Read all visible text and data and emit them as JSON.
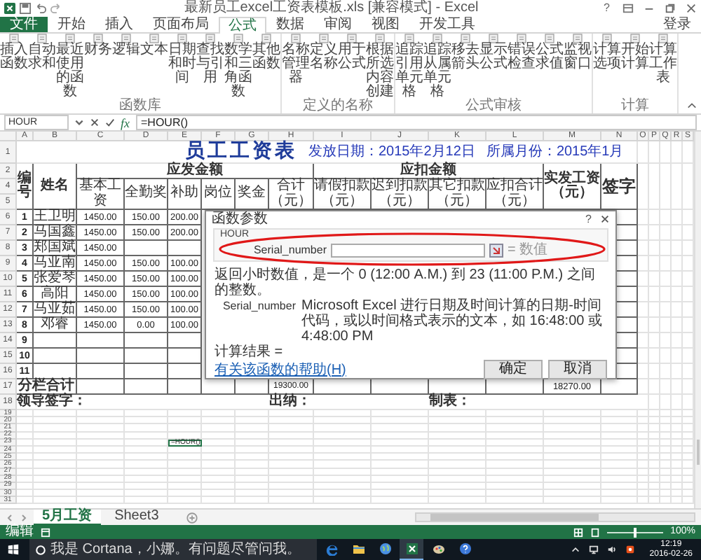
{
  "window": {
    "title": "最新员工excel工资表模板.xls [兼容模式] - Excel",
    "help": "?",
    "account": "登录"
  },
  "ribbon": {
    "tabs": [
      {
        "label": "文件",
        "kind": "file",
        "selected": false
      },
      {
        "label": "开始",
        "kind": "tab",
        "selected": false
      },
      {
        "label": "插入",
        "kind": "tab",
        "selected": false
      },
      {
        "label": "页面布局",
        "kind": "tab",
        "selected": false
      },
      {
        "label": "公式",
        "kind": "tab",
        "selected": true
      },
      {
        "label": "数据",
        "kind": "tab",
        "selected": false
      },
      {
        "label": "审阅",
        "kind": "tab",
        "selected": false
      },
      {
        "label": "视图",
        "kind": "tab",
        "selected": false
      },
      {
        "label": "开发工具",
        "kind": "tab",
        "selected": false
      }
    ],
    "groups": [
      {
        "label": "函数库",
        "items": [
          "插入函数",
          "自动求和",
          "最近使用的函数",
          "财务",
          "逻辑",
          "文本",
          "日期和时间",
          "查找与引用",
          "数学和三角函数",
          "其他函数"
        ]
      },
      {
        "label": "定义的名称",
        "items": [
          "名称管理器",
          "定义名称",
          "用于公式",
          "根据所选内容创建"
        ]
      },
      {
        "label": "公式审核",
        "items": [
          "追踪引用单元格",
          "追踪从属单元格",
          "移去箭头",
          "显示公式",
          "错误检查",
          "公式求值",
          "监视窗口"
        ]
      },
      {
        "label": "计算",
        "items": [
          "计算选项",
          "开始计算",
          "计算工作表"
        ]
      }
    ]
  },
  "formula_bar": {
    "name_box": "HOUR",
    "fx": "fx",
    "formula": "=HOUR()"
  },
  "sheet": {
    "column_letters": [
      "A",
      "B",
      "C",
      "D",
      "E",
      "F",
      "G",
      "H",
      "I",
      "J",
      "K",
      "L",
      "M",
      "N",
      "O",
      "P",
      "Q",
      "R",
      "S"
    ],
    "row_numbers": [
      "1",
      "2",
      "4",
      "5",
      "6",
      "7",
      "8",
      "9",
      "10",
      "11",
      "12",
      "13",
      "14",
      "15",
      "16",
      "17",
      "18",
      "19",
      "20",
      "21",
      "22",
      "23",
      "24",
      "25",
      "26",
      "27",
      "28",
      "29",
      "30",
      "31"
    ],
    "title": "员工工资表",
    "issue_date": "发放日期：2015年2月12日",
    "pay_month": "所属月份：2015年1月",
    "group_headers": [
      "应发金额",
      "应扣金额"
    ],
    "headers": [
      "编号",
      "姓名",
      "基本工资",
      "全勤奖",
      "补助",
      "岗位",
      "奖金",
      "合计（元）",
      "请假扣款（元）",
      "迟到扣款（元）",
      "其它扣款（元）",
      "应扣合计（元）",
      "实发工资（元）",
      "签字"
    ],
    "employees": [
      {
        "no": "1",
        "name": "王卫明",
        "base": "1450.00",
        "attendance": "150.00",
        "allowance": "200.00"
      },
      {
        "no": "2",
        "name": "马国鑫",
        "base": "1450.00",
        "attendance": "150.00",
        "allowance": "200.00"
      },
      {
        "no": "3",
        "name": "郑国斌",
        "base": "1450.00"
      },
      {
        "no": "4",
        "name": "马亚南",
        "base": "1450.00",
        "attendance": "150.00",
        "allowance": "100.00"
      },
      {
        "no": "5",
        "name": "张爱琴",
        "base": "1450.00",
        "attendance": "150.00",
        "allowance": "100.00"
      },
      {
        "no": "6",
        "name": "高阳",
        "base": "1450.00",
        "attendance": "150.00",
        "allowance": "100.00"
      },
      {
        "no": "7",
        "name": "马亚茹",
        "base": "1450.00",
        "attendance": "150.00",
        "allowance": "100.00"
      },
      {
        "no": "8",
        "name": "邓睿",
        "base": "1450.00",
        "attendance": "0.00",
        "allowance": "100.00"
      },
      {
        "no": "9"
      },
      {
        "no": "10"
      },
      {
        "no": "11"
      }
    ],
    "total_label": "分栏合计",
    "total_gross": "19300.00",
    "total_net": "18270.00",
    "signatures": [
      "领导签字：",
      "出纳：",
      "制表："
    ],
    "active_cell_value": "=HOUR()"
  },
  "dialog": {
    "title": "函数参数",
    "help": "?",
    "function": "HOUR",
    "argument_label": "Serial_number",
    "argument_result": "= 数值",
    "description": "返回小时数值，是一个 0 (12:00 A.M.) 到 23 (11:00 P.M.) 之间的整数。",
    "argument_name": "Serial_number",
    "argument_description": "Microsoft Excel 进行日期及时间计算的日期-时间代码，或以时间格式表示的文本，如 16:48:00 或 4:48:00 PM",
    "result_label": "计算结果 =",
    "help_link": "有关该函数的帮助(H)",
    "buttons": [
      "确定",
      "取消"
    ]
  },
  "sheet_tabs": [
    {
      "label": "5月工资",
      "selected": true
    },
    {
      "label": "Sheet3",
      "selected": false
    }
  ],
  "status_bar": {
    "mode": "编辑",
    "zoom": {
      "level": 0.5,
      "reading": "100%"
    }
  },
  "taskbar": {
    "placeholder": "我是 Cortana，小娜。有问题尽管问我。",
    "apps": [
      {
        "kind": "edge",
        "selected": false
      },
      {
        "kind": "folder",
        "selected": false
      },
      {
        "kind": "globe",
        "selected": false
      },
      {
        "kind": "excel",
        "selected": true
      },
      {
        "kind": "paint",
        "selected": false
      },
      {
        "kind": "help",
        "selected": false
      }
    ],
    "time": "12:19",
    "date": "2016-02-26"
  }
}
